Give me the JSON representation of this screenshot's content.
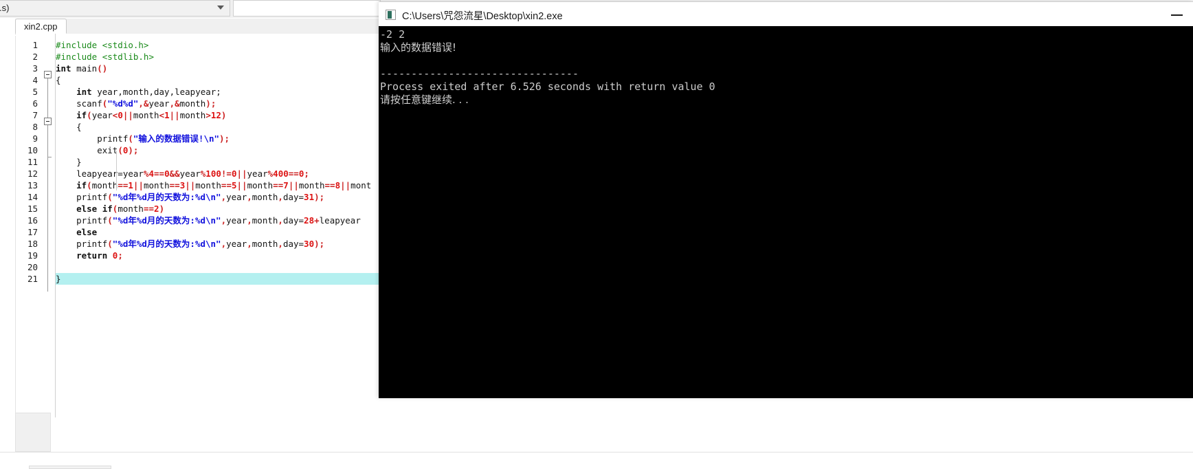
{
  "ide": {
    "combo_value": ".s)",
    "combo_icon": "chevron-down-icon",
    "tab_label": "xin2.cpp",
    "line_numbers": [
      "1",
      "2",
      "3",
      "4",
      "5",
      "6",
      "7",
      "8",
      "9",
      "10",
      "11",
      "12",
      "13",
      "14",
      "15",
      "16",
      "17",
      "18",
      "19",
      "20",
      "21"
    ],
    "code_lines": [
      {
        "n": 1,
        "segs": [
          {
            "t": "#include <stdio.h>",
            "c": "c-pre"
          }
        ]
      },
      {
        "n": 2,
        "segs": [
          {
            "t": "#include <stdlib.h>",
            "c": "c-pre"
          }
        ]
      },
      {
        "n": 3,
        "segs": [
          {
            "t": "int",
            "c": "c-kw"
          },
          {
            "t": " main",
            "c": "c-plain"
          },
          {
            "t": "()",
            "c": "c-punct"
          }
        ]
      },
      {
        "n": 4,
        "segs": [
          {
            "t": "{",
            "c": "c-plain"
          }
        ]
      },
      {
        "n": 5,
        "segs": [
          {
            "t": "    int",
            "c": "c-kw"
          },
          {
            "t": " year,month,day,leapyear;",
            "c": "c-plain"
          }
        ]
      },
      {
        "n": 6,
        "segs": [
          {
            "t": "    scanf",
            "c": "c-plain"
          },
          {
            "t": "(",
            "c": "c-punct"
          },
          {
            "t": "\"%d%d\"",
            "c": "c-str"
          },
          {
            "t": ",",
            "c": "c-punct"
          },
          {
            "t": "&",
            "c": "c-op"
          },
          {
            "t": "year",
            "c": "c-plain"
          },
          {
            "t": ",",
            "c": "c-punct"
          },
          {
            "t": "&",
            "c": "c-op"
          },
          {
            "t": "month",
            "c": "c-plain"
          },
          {
            "t": ");",
            "c": "c-punct"
          }
        ]
      },
      {
        "n": 7,
        "segs": [
          {
            "t": "    if",
            "c": "c-kw"
          },
          {
            "t": "(",
            "c": "c-punct"
          },
          {
            "t": "year",
            "c": "c-plain"
          },
          {
            "t": "<",
            "c": "c-op"
          },
          {
            "t": "0",
            "c": "c-num"
          },
          {
            "t": "||",
            "c": "c-op"
          },
          {
            "t": "month",
            "c": "c-plain"
          },
          {
            "t": "<",
            "c": "c-op"
          },
          {
            "t": "1",
            "c": "c-num"
          },
          {
            "t": "||",
            "c": "c-op"
          },
          {
            "t": "month",
            "c": "c-plain"
          },
          {
            "t": ">",
            "c": "c-op"
          },
          {
            "t": "12",
            "c": "c-num"
          },
          {
            "t": ")",
            "c": "c-punct"
          }
        ]
      },
      {
        "n": 8,
        "segs": [
          {
            "t": "    {",
            "c": "c-plain"
          }
        ]
      },
      {
        "n": 9,
        "segs": [
          {
            "t": "        printf",
            "c": "c-plain"
          },
          {
            "t": "(",
            "c": "c-punct"
          },
          {
            "t": "\"输入的数据错误!\\n\"",
            "c": "c-str"
          },
          {
            "t": ");",
            "c": "c-punct"
          }
        ]
      },
      {
        "n": 10,
        "segs": [
          {
            "t": "        exit",
            "c": "c-plain"
          },
          {
            "t": "(",
            "c": "c-punct"
          },
          {
            "t": "0",
            "c": "c-num"
          },
          {
            "t": ");",
            "c": "c-punct"
          }
        ]
      },
      {
        "n": 11,
        "segs": [
          {
            "t": "    }",
            "c": "c-plain"
          }
        ]
      },
      {
        "n": 12,
        "segs": [
          {
            "t": "    leapyear=year",
            "c": "c-plain"
          },
          {
            "t": "%",
            "c": "c-op"
          },
          {
            "t": "4",
            "c": "c-num"
          },
          {
            "t": "==",
            "c": "c-op"
          },
          {
            "t": "0",
            "c": "c-num"
          },
          {
            "t": "&&",
            "c": "c-op"
          },
          {
            "t": "year",
            "c": "c-plain"
          },
          {
            "t": "%",
            "c": "c-op"
          },
          {
            "t": "100",
            "c": "c-num"
          },
          {
            "t": "!=",
            "c": "c-op"
          },
          {
            "t": "0",
            "c": "c-num"
          },
          {
            "t": "||",
            "c": "c-op"
          },
          {
            "t": "year",
            "c": "c-plain"
          },
          {
            "t": "%",
            "c": "c-op"
          },
          {
            "t": "400",
            "c": "c-num"
          },
          {
            "t": "==",
            "c": "c-op"
          },
          {
            "t": "0",
            "c": "c-num"
          },
          {
            "t": ";",
            "c": "c-punct"
          }
        ]
      },
      {
        "n": 13,
        "segs": [
          {
            "t": "    if",
            "c": "c-kw"
          },
          {
            "t": "(",
            "c": "c-punct"
          },
          {
            "t": "month",
            "c": "c-plain"
          },
          {
            "t": "==",
            "c": "c-op"
          },
          {
            "t": "1",
            "c": "c-num"
          },
          {
            "t": "||",
            "c": "c-op"
          },
          {
            "t": "month",
            "c": "c-plain"
          },
          {
            "t": "==",
            "c": "c-op"
          },
          {
            "t": "3",
            "c": "c-num"
          },
          {
            "t": "||",
            "c": "c-op"
          },
          {
            "t": "month",
            "c": "c-plain"
          },
          {
            "t": "==",
            "c": "c-op"
          },
          {
            "t": "5",
            "c": "c-num"
          },
          {
            "t": "||",
            "c": "c-op"
          },
          {
            "t": "month",
            "c": "c-plain"
          },
          {
            "t": "==",
            "c": "c-op"
          },
          {
            "t": "7",
            "c": "c-num"
          },
          {
            "t": "||",
            "c": "c-op"
          },
          {
            "t": "month",
            "c": "c-plain"
          },
          {
            "t": "==",
            "c": "c-op"
          },
          {
            "t": "8",
            "c": "c-num"
          },
          {
            "t": "||",
            "c": "c-op"
          },
          {
            "t": "mont",
            "c": "c-plain"
          }
        ]
      },
      {
        "n": 14,
        "segs": [
          {
            "t": "    printf",
            "c": "c-plain"
          },
          {
            "t": "(",
            "c": "c-punct"
          },
          {
            "t": "\"%d年%d月的天数为:%d\\n\"",
            "c": "c-str"
          },
          {
            "t": ",",
            "c": "c-punct"
          },
          {
            "t": "year",
            "c": "c-plain"
          },
          {
            "t": ",",
            "c": "c-punct"
          },
          {
            "t": "month",
            "c": "c-plain"
          },
          {
            "t": ",",
            "c": "c-punct"
          },
          {
            "t": "day=",
            "c": "c-plain"
          },
          {
            "t": "31",
            "c": "c-num"
          },
          {
            "t": ");",
            "c": "c-punct"
          }
        ]
      },
      {
        "n": 15,
        "segs": [
          {
            "t": "    else if",
            "c": "c-kw"
          },
          {
            "t": "(",
            "c": "c-punct"
          },
          {
            "t": "month",
            "c": "c-plain"
          },
          {
            "t": "==",
            "c": "c-op"
          },
          {
            "t": "2",
            "c": "c-num"
          },
          {
            "t": ")",
            "c": "c-punct"
          }
        ]
      },
      {
        "n": 16,
        "segs": [
          {
            "t": "    printf",
            "c": "c-plain"
          },
          {
            "t": "(",
            "c": "c-punct"
          },
          {
            "t": "\"%d年%d月的天数为:%d\\n\"",
            "c": "c-str"
          },
          {
            "t": ",",
            "c": "c-punct"
          },
          {
            "t": "year",
            "c": "c-plain"
          },
          {
            "t": ",",
            "c": "c-punct"
          },
          {
            "t": "month",
            "c": "c-plain"
          },
          {
            "t": ",",
            "c": "c-punct"
          },
          {
            "t": "day=",
            "c": "c-plain"
          },
          {
            "t": "28",
            "c": "c-num"
          },
          {
            "t": "+",
            "c": "c-op"
          },
          {
            "t": "leapyear",
            "c": "c-plain"
          }
        ]
      },
      {
        "n": 17,
        "segs": [
          {
            "t": "    else",
            "c": "c-kw"
          }
        ]
      },
      {
        "n": 18,
        "segs": [
          {
            "t": "    printf",
            "c": "c-plain"
          },
          {
            "t": "(",
            "c": "c-punct"
          },
          {
            "t": "\"%d年%d月的天数为:%d\\n\"",
            "c": "c-str"
          },
          {
            "t": ",",
            "c": "c-punct"
          },
          {
            "t": "year",
            "c": "c-plain"
          },
          {
            "t": ",",
            "c": "c-punct"
          },
          {
            "t": "month",
            "c": "c-plain"
          },
          {
            "t": ",",
            "c": "c-punct"
          },
          {
            "t": "day=",
            "c": "c-plain"
          },
          {
            "t": "30",
            "c": "c-num"
          },
          {
            "t": ");",
            "c": "c-punct"
          }
        ]
      },
      {
        "n": 19,
        "segs": [
          {
            "t": "    return",
            "c": "c-kw"
          },
          {
            "t": " ",
            "c": "c-plain"
          },
          {
            "t": "0",
            "c": "c-num"
          },
          {
            "t": ";",
            "c": "c-punct"
          }
        ]
      },
      {
        "n": 20,
        "segs": []
      },
      {
        "n": 21,
        "segs": [
          {
            "t": "}",
            "c": "c-plain"
          }
        ]
      }
    ],
    "highlighted_line": 21
  },
  "console": {
    "title": "C:\\Users\\咒怨流星\\Desktop\\xin2.exe",
    "icon": "console-window-icon",
    "minimize_label": "minimize-icon",
    "output_lines": [
      "-2 2",
      "输入的数据错误!",
      "",
      "--------------------------------",
      "Process exited after 6.526 seconds with return value 0",
      "请按任意键继续. . ."
    ]
  }
}
